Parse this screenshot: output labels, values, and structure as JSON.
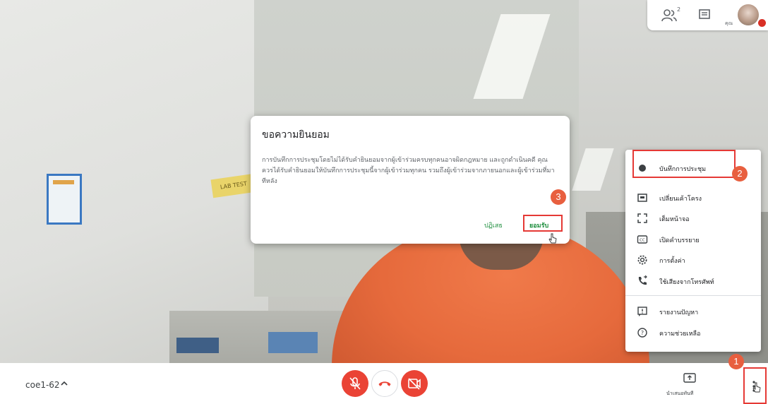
{
  "top_panel": {
    "participant_count": "2",
    "you_label": "คุณ"
  },
  "dialog": {
    "title": "ขอความยินยอม",
    "body": "การบันทึกการประชุมโดยไม่ได้รับคำยินยอมจากผู้เข้าร่วมครบทุกคนอาจผิดกฎหมาย และถูกดำเนินคดี คุณควรได้รับคำยินยอมให้บันทึกการประชุมนี้จากผู้เข้าร่วมทุกคน รวมถึงผู้เข้าร่วมจากภายนอกและผู้เข้าร่วมที่มาทีหลัง",
    "deny_label": "ปฏิเสธ",
    "accept_label": "ยอมรับ"
  },
  "menu": {
    "items": [
      {
        "label": "บันทึกการประชุม",
        "icon": "record-dot-icon"
      },
      {
        "label": "เปลี่ยนเค้าโครง",
        "icon": "layout-icon"
      },
      {
        "label": "เต็มหน้าจอ",
        "icon": "fullscreen-icon"
      },
      {
        "label": "เปิดคำบรรยาย",
        "icon": "captions-icon"
      },
      {
        "label": "การตั้งค่า",
        "icon": "gear-icon"
      },
      {
        "label": "ใช้เสียงจากโทรศัพท์",
        "icon": "phone-audio-icon"
      },
      {
        "label": "รายงานปัญหา",
        "icon": "report-icon"
      },
      {
        "label": "ความช่วยเหลือ",
        "icon": "help-icon"
      }
    ]
  },
  "steps": [
    "1",
    "2",
    "3"
  ],
  "bottom_bar": {
    "meeting_code": "coe1-62",
    "present_label": "นำเสนอทันที"
  },
  "colors": {
    "accent_green": "#1e8e3e",
    "end_red": "#ea4335",
    "highlight_red": "#e53935",
    "step_orange": "#e85f3f"
  }
}
